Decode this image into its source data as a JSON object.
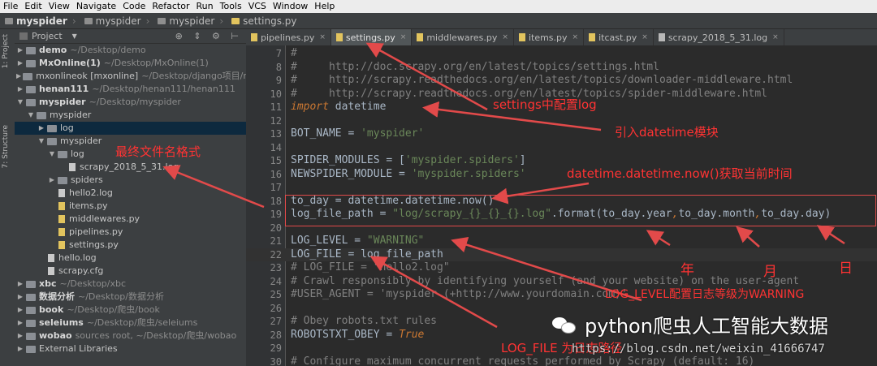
{
  "menu": [
    "File",
    "Edit",
    "View",
    "Navigate",
    "Code",
    "Refactor",
    "Run",
    "Tools",
    "VCS",
    "Window",
    "Help"
  ],
  "breadcrumb": [
    "myspider",
    "myspider",
    "myspider",
    "settings.py"
  ],
  "toolwindow": {
    "project_tab": "1: Project",
    "structure_tab": "7: Structure"
  },
  "project_panel": {
    "title": "Project"
  },
  "tree": [
    {
      "depth": 0,
      "arrow": "▶",
      "type": "folder",
      "name": "demo",
      "path": "~/Desktop/demo",
      "bold": true
    },
    {
      "depth": 0,
      "arrow": "▶",
      "type": "folder",
      "name": "MxOnline(1)",
      "path": "~/Desktop/MxOnline(1)",
      "bold": true
    },
    {
      "depth": 0,
      "arrow": "▶",
      "type": "folder",
      "name": "mxonlineok [mxonline]",
      "path": "~/Desktop/django项目/mx",
      "bold": false
    },
    {
      "depth": 0,
      "arrow": "▶",
      "type": "folder",
      "name": "henan111",
      "path": "~/Desktop/henan111/henan111",
      "bold": true
    },
    {
      "depth": 0,
      "arrow": "▼",
      "type": "folder",
      "name": "myspider",
      "path": "~/Desktop/myspider",
      "bold": true
    },
    {
      "depth": 1,
      "arrow": "▼",
      "type": "folder",
      "name": "myspider",
      "path": "",
      "bold": false
    },
    {
      "depth": 2,
      "arrow": "▶",
      "type": "folder",
      "name": "log",
      "path": "",
      "bold": false,
      "selected": true
    },
    {
      "depth": 2,
      "arrow": "▼",
      "type": "folder",
      "name": "myspider",
      "path": "",
      "bold": false
    },
    {
      "depth": 3,
      "arrow": "▼",
      "type": "folder",
      "name": "log",
      "path": "",
      "bold": false
    },
    {
      "depth": 4,
      "arrow": "",
      "type": "file",
      "name": "scrapy_2018_5_31.log",
      "path": "",
      "bold": false
    },
    {
      "depth": 3,
      "arrow": "▶",
      "type": "folder",
      "name": "spiders",
      "path": "",
      "bold": false
    },
    {
      "depth": 3,
      "arrow": "",
      "type": "file",
      "name": "hello2.log",
      "path": "",
      "bold": false
    },
    {
      "depth": 3,
      "arrow": "",
      "type": "py",
      "name": "items.py",
      "path": "",
      "bold": false
    },
    {
      "depth": 3,
      "arrow": "",
      "type": "py",
      "name": "middlewares.py",
      "path": "",
      "bold": false
    },
    {
      "depth": 3,
      "arrow": "",
      "type": "py",
      "name": "pipelines.py",
      "path": "",
      "bold": false
    },
    {
      "depth": 3,
      "arrow": "",
      "type": "py",
      "name": "settings.py",
      "path": "",
      "bold": false
    },
    {
      "depth": 2,
      "arrow": "",
      "type": "file",
      "name": "hello.log",
      "path": "",
      "bold": false
    },
    {
      "depth": 2,
      "arrow": "",
      "type": "file",
      "name": "scrapy.cfg",
      "path": "",
      "bold": false
    },
    {
      "depth": 0,
      "arrow": "▶",
      "type": "folder",
      "name": "xbc",
      "path": "~/Desktop/xbc",
      "bold": true
    },
    {
      "depth": 0,
      "arrow": "▶",
      "type": "folder",
      "name": "数据分析",
      "path": "~/Desktop/数据分析",
      "bold": true
    },
    {
      "depth": 0,
      "arrow": "▶",
      "type": "folder",
      "name": "book",
      "path": "~/Desktop/爬虫/book",
      "bold": true
    },
    {
      "depth": 0,
      "arrow": "▶",
      "type": "folder",
      "name": "seleiums",
      "path": "~/Desktop/爬虫/seleiums",
      "bold": true
    },
    {
      "depth": 0,
      "arrow": "▶",
      "type": "folder",
      "name": "wobao",
      "path": "sources root, ~/Desktop/爬虫/wobao",
      "bold": true
    },
    {
      "depth": 0,
      "arrow": "▶",
      "type": "folder",
      "name": "External Libraries",
      "path": "",
      "bold": false
    }
  ],
  "tabs": [
    {
      "label": "pipelines.py",
      "type": "py",
      "active": false
    },
    {
      "label": "settings.py",
      "type": "py",
      "active": true
    },
    {
      "label": "middlewares.py",
      "type": "py",
      "active": false
    },
    {
      "label": "items.py",
      "type": "py",
      "active": false
    },
    {
      "label": "itcast.py",
      "type": "py",
      "active": false
    },
    {
      "label": "scrapy_2018_5_31.log",
      "type": "log",
      "active": false
    }
  ],
  "code_lines": [
    {
      "n": "7",
      "parts": [
        [
          "cm",
          "#"
        ]
      ]
    },
    {
      "n": "8",
      "parts": [
        [
          "cm",
          "#     http://doc.scrapy.org/en/latest/topics/settings.html"
        ]
      ]
    },
    {
      "n": "9",
      "parts": [
        [
          "cm",
          "#     http://scrapy.readthedocs.org/en/latest/topics/downloader-middleware.html"
        ]
      ]
    },
    {
      "n": "10",
      "parts": [
        [
          "cm",
          "#     http://scrapy.readthedocs.org/en/latest/topics/spider-middleware.html"
        ]
      ]
    },
    {
      "n": "11",
      "parts": [
        [
          "kw",
          "import"
        ],
        [
          "fn",
          " datetime"
        ]
      ]
    },
    {
      "n": "12",
      "parts": []
    },
    {
      "n": "13",
      "parts": [
        [
          "fn",
          "BOT_NAME = "
        ],
        [
          "str",
          "'myspider'"
        ]
      ]
    },
    {
      "n": "14",
      "parts": []
    },
    {
      "n": "15",
      "parts": [
        [
          "fn",
          "SPIDER_MODULES = ["
        ],
        [
          "str",
          "'myspider.spiders'"
        ],
        [
          "fn",
          "]"
        ]
      ]
    },
    {
      "n": "16",
      "parts": [
        [
          "fn",
          "NEWSPIDER_MODULE = "
        ],
        [
          "str",
          "'myspider.spiders'"
        ]
      ]
    },
    {
      "n": "17",
      "parts": []
    },
    {
      "n": "18",
      "parts": [
        [
          "fn",
          "to_day = datetime.datetime.now()"
        ]
      ]
    },
    {
      "n": "19",
      "parts": [
        [
          "fn",
          "log_file_path = "
        ],
        [
          "str",
          "\"log/scrapy_{}_{}_{}.log\""
        ],
        [
          "fn",
          ".format(to_day.year"
        ],
        [
          "kw",
          ","
        ],
        [
          "fn",
          "to_day.month"
        ],
        [
          "kw",
          ","
        ],
        [
          "fn",
          "to_day.day)"
        ]
      ]
    },
    {
      "n": "20",
      "parts": []
    },
    {
      "n": "21",
      "parts": [
        [
          "fn",
          "LOG_LEVEL = "
        ],
        [
          "str",
          "\"WARNING\""
        ]
      ]
    },
    {
      "n": "22",
      "parts": [
        [
          "fn",
          "LOG_FILE = log_file_path"
        ]
      ],
      "hl": true
    },
    {
      "n": "23",
      "parts": [
        [
          "cm",
          "# LOG_FILE = \"hello2.log\""
        ]
      ]
    },
    {
      "n": "24",
      "parts": [
        [
          "cm",
          "# Crawl responsibly by identifying yourself (and your website) on the user-agent"
        ]
      ]
    },
    {
      "n": "25",
      "parts": [
        [
          "cm",
          "#USER_AGENT = 'myspider (+http://www.yourdomain.com)'"
        ]
      ]
    },
    {
      "n": "26",
      "parts": []
    },
    {
      "n": "27",
      "parts": [
        [
          "cm",
          "# Obey robots.txt rules"
        ]
      ]
    },
    {
      "n": "28",
      "parts": [
        [
          "fn",
          "ROBOTSTXT_OBEY = "
        ],
        [
          "kw",
          "True"
        ]
      ]
    },
    {
      "n": "29",
      "parts": []
    },
    {
      "n": "30",
      "parts": [
        [
          "cm",
          "# Configure maximum concurrent requests performed by Scrapy (default: 16)"
        ]
      ]
    }
  ],
  "annotations": {
    "settings_log": "settings中配置log",
    "import_datetime": "引入datetime模块",
    "filename_format": "最终文件名格式",
    "now_time": "datetime.datetime.now()获取当前时间",
    "year": "年",
    "month": "月",
    "day": "日",
    "log_level": "LOG_LEVEL配置日志等级为WARNING",
    "log_file": "LOG_FILE 为日志路径"
  },
  "watermark": {
    "text": "python爬虫人工智能大数据",
    "url": "https://blog.csdn.net/weixin_41666747"
  },
  "colors": {
    "annotation": "#ff3333",
    "selection": "#0d293e",
    "editor_bg": "#2b2b2b",
    "panel_bg": "#3c3f41"
  }
}
